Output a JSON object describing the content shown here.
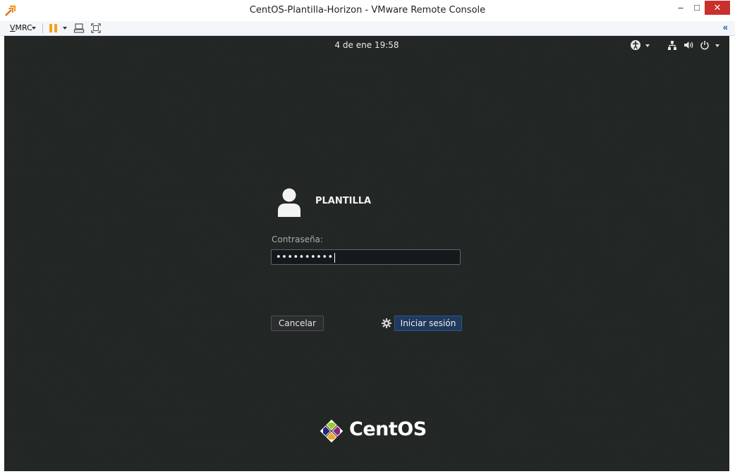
{
  "window": {
    "title": "CentOS-Plantilla-Horizon - VMware Remote Console",
    "minimize_glyph": "–",
    "maximize_glyph": "□",
    "close_glyph": "✕"
  },
  "toolbar": {
    "menu_label_underlined": "V",
    "menu_label_rest": "MRC",
    "collapse_glyph": "«"
  },
  "topbar": {
    "clock": "4 de ene  19:58",
    "icons": [
      "accessibility-icon",
      "network-icon",
      "volume-icon",
      "power-icon"
    ]
  },
  "login": {
    "username": "PLANTILLA",
    "password_label": "Contraseña:",
    "password_value": "••••••••••",
    "cancel_label": "Cancelar",
    "login_label": "Iniciar sesión"
  },
  "branding": {
    "logo_text": "CentOS"
  },
  "colors": {
    "background": "#222625",
    "login_button": "#1f3a5c",
    "pause_icon": "#f0a21e",
    "close_button": "#c9302c"
  }
}
